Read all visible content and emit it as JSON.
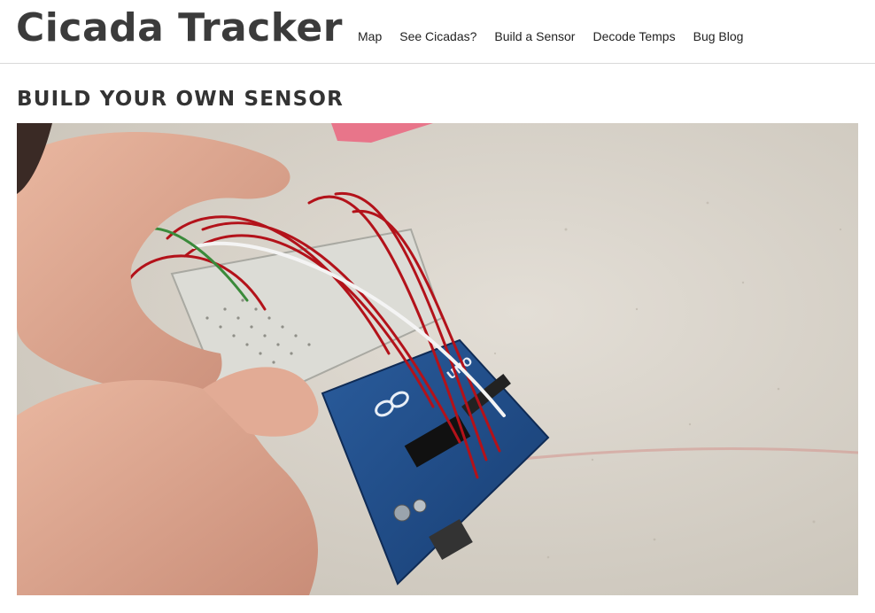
{
  "site": {
    "title": "Cicada Tracker"
  },
  "nav": {
    "items": [
      {
        "label": "Map"
      },
      {
        "label": "See Cicadas?"
      },
      {
        "label": "Build a Sensor"
      },
      {
        "label": "Decode Temps"
      },
      {
        "label": "Bug Blog"
      }
    ]
  },
  "page": {
    "heading": "BUILD YOUR OWN SENSOR"
  },
  "photo": {
    "subject": "hands wiring an Arduino board to a breadboard with red jumper wires",
    "board_label": "UNO"
  },
  "colors": {
    "title": "#3b3b3b",
    "heading": "#333333",
    "board": "#1f4f8f",
    "wire": "#b3121a",
    "countertop": "#d8d3ca"
  }
}
